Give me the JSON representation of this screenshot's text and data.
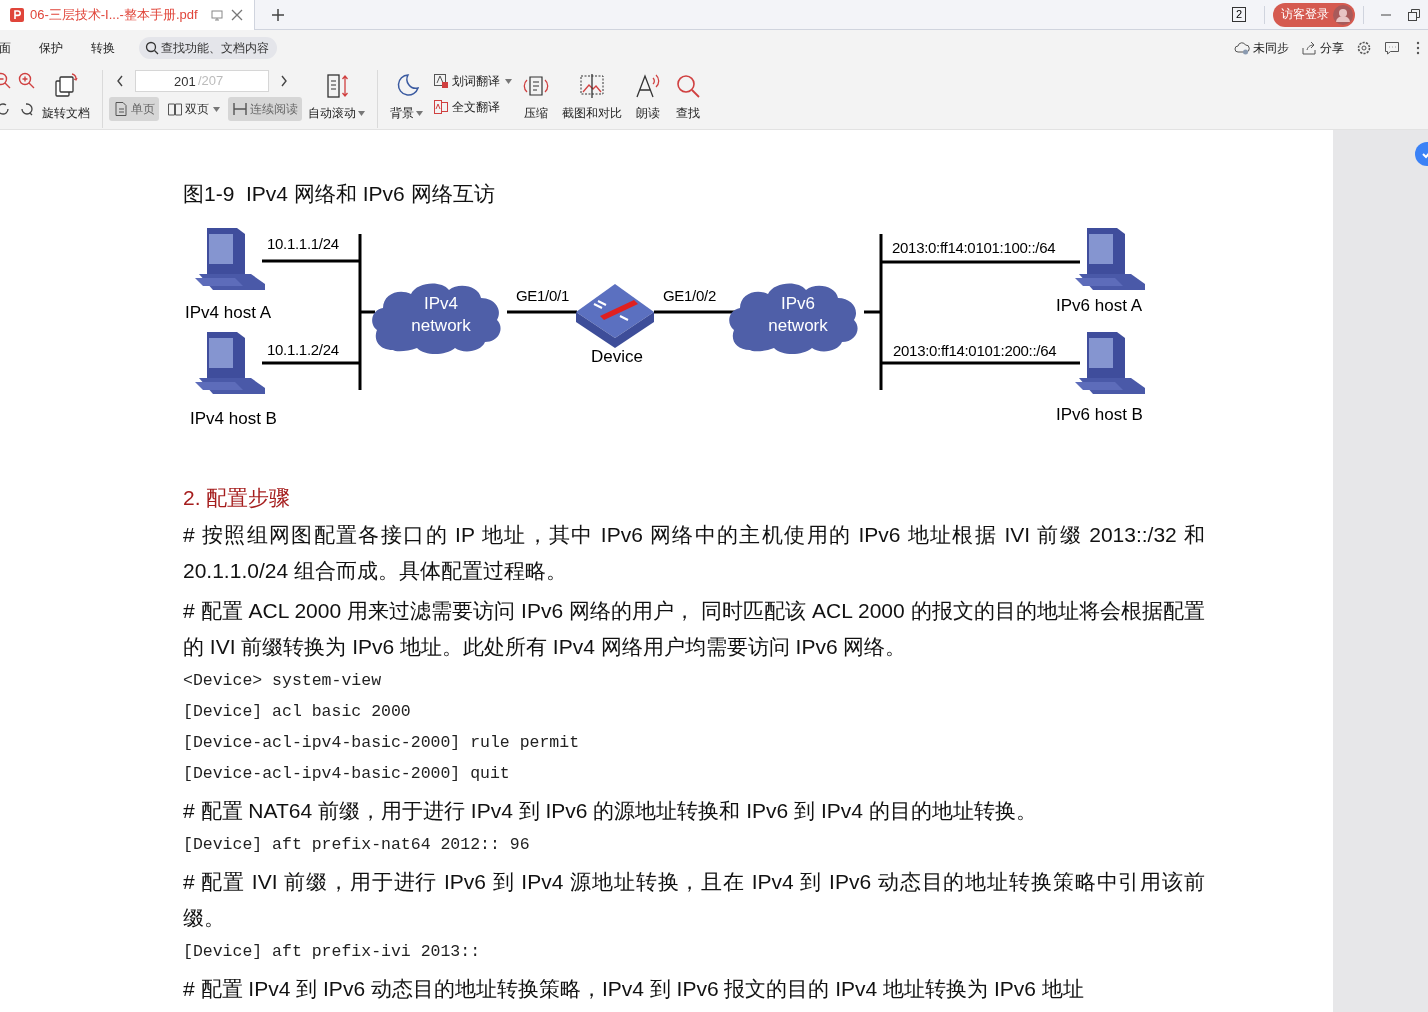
{
  "tabs": [
    {
      "title": "06-三层技术-I...-整本手册.pdf",
      "selected": true
    }
  ],
  "title_bar": {
    "window_count": "2",
    "login_button": "访客登录"
  },
  "menu": [
    {
      "label": "面"
    },
    {
      "label": "保护"
    },
    {
      "label": "转换"
    }
  ],
  "search": {
    "placeholder": "查找功能、文档内容"
  },
  "right_actions": [
    {
      "kind": "cloud",
      "label": "未同步"
    },
    {
      "kind": "share",
      "label": "分享"
    },
    {
      "kind": "gear"
    },
    {
      "kind": "comment"
    },
    {
      "kind": "more"
    }
  ],
  "toolbar": {
    "rotate_label": "旋转文档",
    "page_field": {
      "value": "201",
      "total": "/207"
    },
    "view_modes": [
      {
        "kind": "single",
        "label": "单页",
        "selected": true,
        "dropdown": false
      },
      {
        "kind": "double",
        "label": "双页",
        "selected": false,
        "dropdown": true
      },
      {
        "kind": "continuous",
        "label": "连续阅读",
        "selected": true,
        "dropdown": false
      }
    ],
    "auto_scroll": {
      "label": "自动滚动",
      "dropdown": true
    },
    "background": {
      "label": "背景",
      "dropdown": true
    },
    "translate": [
      {
        "kind": "word",
        "label": "划词翻译",
        "dropdown": true
      },
      {
        "kind": "full",
        "label": "全文翻译",
        "dropdown": false
      }
    ],
    "tools": [
      {
        "kind": "compress",
        "label": "压缩"
      },
      {
        "kind": "screenshot",
        "label": "截图和对比"
      },
      {
        "kind": "read",
        "label": "朗读"
      },
      {
        "kind": "find",
        "label": "查找"
      }
    ]
  },
  "document": {
    "figure_title": "图1-9  IPv4 网络和 IPv6 网络互访",
    "diagram": {
      "hosts": [
        {
          "label": "IPv4 host A",
          "address": "10.1.1.1/24"
        },
        {
          "label": "IPv4 host B",
          "address": "10.1.1.2/24"
        },
        {
          "label": "IPv6 host A",
          "address": "2013:0:ff14:0101:100::/64"
        },
        {
          "label": "IPv6 host B",
          "address": "2013:0:ff14:0101:200::/64"
        }
      ],
      "clouds": [
        {
          "label_lines": [
            "IPv4",
            "network"
          ]
        },
        {
          "label_lines": [
            "IPv6",
            "network"
          ]
        }
      ],
      "device": {
        "label": "Device",
        "ports": [
          "GE1/0/1",
          "GE1/0/2"
        ]
      }
    },
    "section_title": "2. 配置步骤",
    "blocks": [
      {
        "kind": "para",
        "text": "# 按照组网图配置各接口的 IP 地址，其中 IPv6 网络中的主机使用的 IPv6 地址根据 IVI 前缀 2013::/32 和 20.1.1.0/24 组合而成。具体配置过程略。"
      },
      {
        "kind": "para",
        "text": "# 配置 ACL 2000 用来过滤需要访问 IPv6 网络的用户， 同时匹配该 ACL 2000 的报文的目的地址将会根据配置的 IVI 前缀转换为 IPv6 地址。此处所有 IPv4 网络用户均需要访问 IPv6 网络。"
      },
      {
        "kind": "code",
        "text": "<Device> system-view"
      },
      {
        "kind": "code",
        "text": "[Device] acl basic 2000"
      },
      {
        "kind": "code",
        "text": "[Device-acl-ipv4-basic-2000] rule permit"
      },
      {
        "kind": "code",
        "text": "[Device-acl-ipv4-basic-2000] quit"
      },
      {
        "kind": "para",
        "text": "# 配置 NAT64 前缀，用于进行 IPv4 到 IPv6 的源地址转换和 IPv6 到 IPv4 的目的地址转换。"
      },
      {
        "kind": "code",
        "text": "[Device] aft prefix-nat64 2012:: 96"
      },
      {
        "kind": "para",
        "text": "# 配置 IVI 前缀，用于进行 IPv6 到 IPv4 源地址转换，且在 IPv4 到 IPv6 动态目的地址转换策略中引用该前缀。"
      },
      {
        "kind": "code",
        "text": "[Device] aft prefix-ivi 2013::"
      },
      {
        "kind": "para",
        "text": "# 配置 IPv4 到 IPv6 动态目的地址转换策略，IPv4 到 IPv6 报文的目的 IPv4 地址转换为 IPv6 地址"
      }
    ]
  }
}
